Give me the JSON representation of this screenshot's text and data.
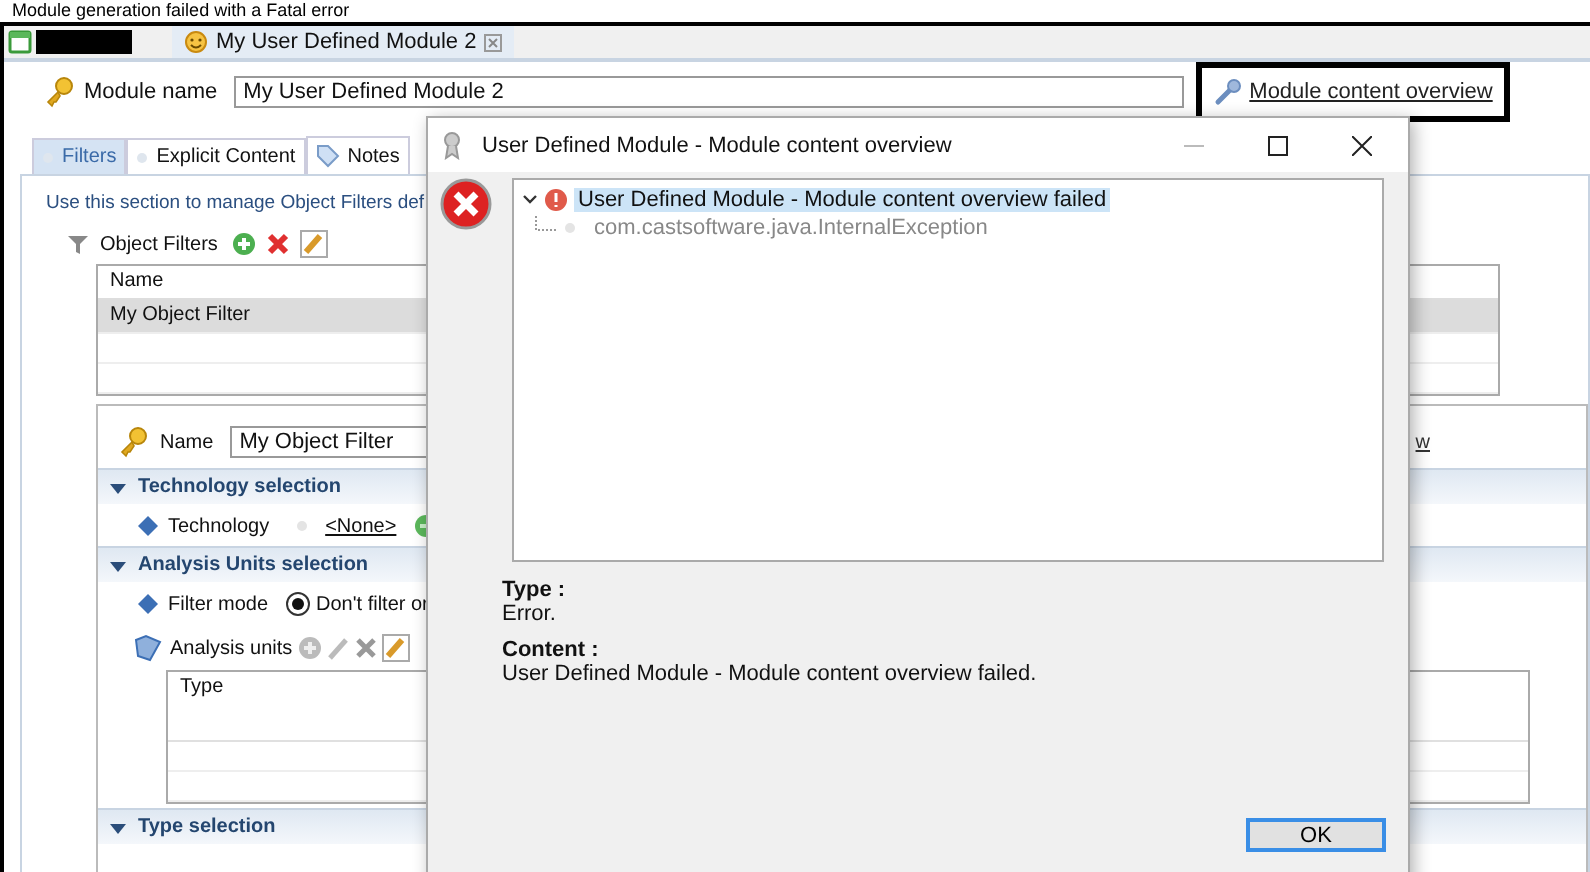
{
  "caption": "Module generation failed with a Fatal error",
  "editor_tab": {
    "title": "My User Defined Module 2",
    "selected": true
  },
  "module_name": {
    "label": "Module name",
    "value": "My User Defined Module 2"
  },
  "overview_link": "Module content overview",
  "tabs": [
    {
      "label": "Filters",
      "selected": true
    },
    {
      "label": "Explicit Content",
      "selected": false
    },
    {
      "label": "Notes",
      "selected": false
    }
  ],
  "description": "Use this section to manage Object Filters def",
  "object_filters": {
    "label": "Object Filters",
    "columns": [
      "Name"
    ],
    "rows": [
      {
        "name": "My Object Filter",
        "selected": true
      }
    ]
  },
  "filter_detail": {
    "name_label": "Name",
    "name_value": "My Object Filter",
    "link_tail": "w",
    "technology_section": {
      "title": "Technology selection",
      "expanded": true,
      "label": "Technology",
      "value": "<None>"
    },
    "analysis_section": {
      "title": "Analysis Units selection",
      "expanded": true,
      "filter_mode_label": "Filter mode",
      "filter_mode_option": {
        "label": "Don't filter or",
        "selected": true
      },
      "units_label": "Analysis units",
      "columns": [
        "Type"
      ]
    },
    "type_section": {
      "title": "Type selection",
      "expanded": true
    }
  },
  "dialog": {
    "title": "User Defined Module - Module content overview",
    "tree": [
      {
        "label": "User Defined Module - Module content overview failed",
        "selected": true,
        "expanded": true,
        "children": [
          {
            "label": "com.castsoftware.java.InternalException",
            "selected": false
          }
        ]
      }
    ],
    "type_label": "Type :",
    "type_value": "Error.",
    "content_label": "Content :",
    "content_value": "User Defined Module - Module content overview failed.",
    "ok": "OK"
  }
}
